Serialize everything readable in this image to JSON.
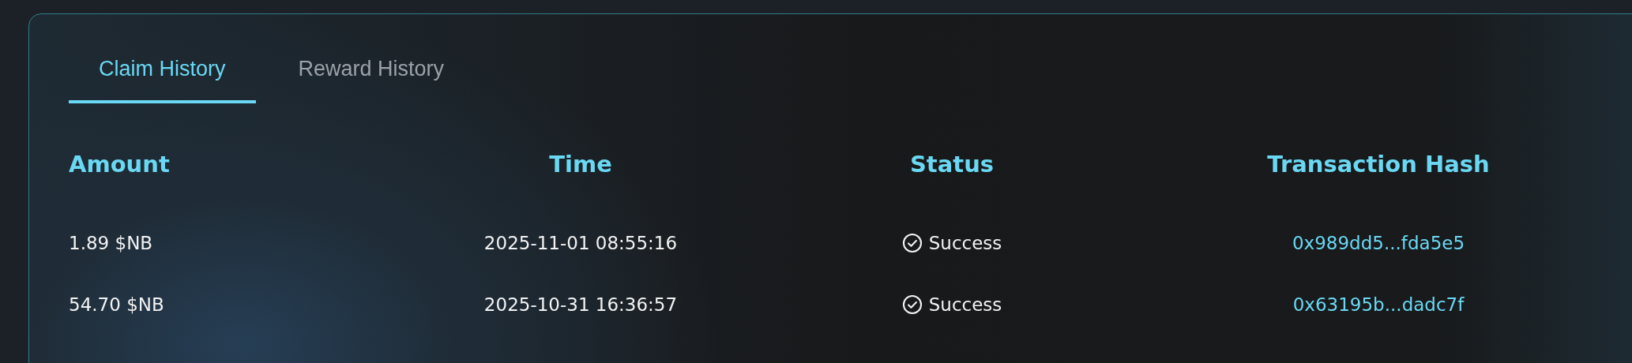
{
  "tabs": [
    {
      "label": "Claim History",
      "selected": true
    },
    {
      "label": "Reward History",
      "selected": false
    }
  ],
  "table": {
    "columns": [
      "Amount",
      "Time",
      "Status",
      "Transaction Hash"
    ],
    "rows": [
      {
        "amount": "1.89 $NB",
        "time": "2025-11-01 08:55:16",
        "status": {
          "kind": "success",
          "label": "Success"
        },
        "hash": "0x989dd5...fda5e5"
      },
      {
        "amount": "54.70 $NB",
        "time": "2025-10-31 16:36:57",
        "status": {
          "kind": "success",
          "label": "Success"
        },
        "hash": "0x63195b...dadc7f"
      }
    ]
  }
}
